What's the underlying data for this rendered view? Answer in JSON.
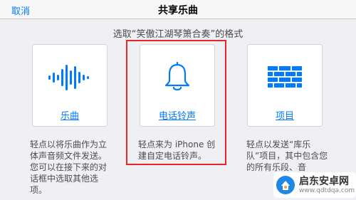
{
  "navbar": {
    "cancel_label": "取消",
    "title": "共享乐曲"
  },
  "subtitle": "选取“笑傲江湖琴箫合奏”的格式",
  "options": {
    "music": {
      "icon": "waveform-icon",
      "label": "乐曲",
      "description": "轻点以将乐曲作为立体声音频文件发送。您可以在接下来的对话框中选取其他选项。"
    },
    "ringtone": {
      "icon": "bell-icon",
      "label": "电话铃声",
      "description": "轻点来为 iPhone 创建自定电话铃声。"
    },
    "project": {
      "icon": "brick-wall-icon",
      "label": "项目",
      "description": "轻点以发送“库乐队”项目，其中包含您的所有乐段、音"
    }
  },
  "colors": {
    "accent": "#007aff",
    "highlight": "#e8262a",
    "background": "#efeff4"
  },
  "watermark": {
    "name": "启东安卓网",
    "url": "www.qdtdqa.com"
  }
}
